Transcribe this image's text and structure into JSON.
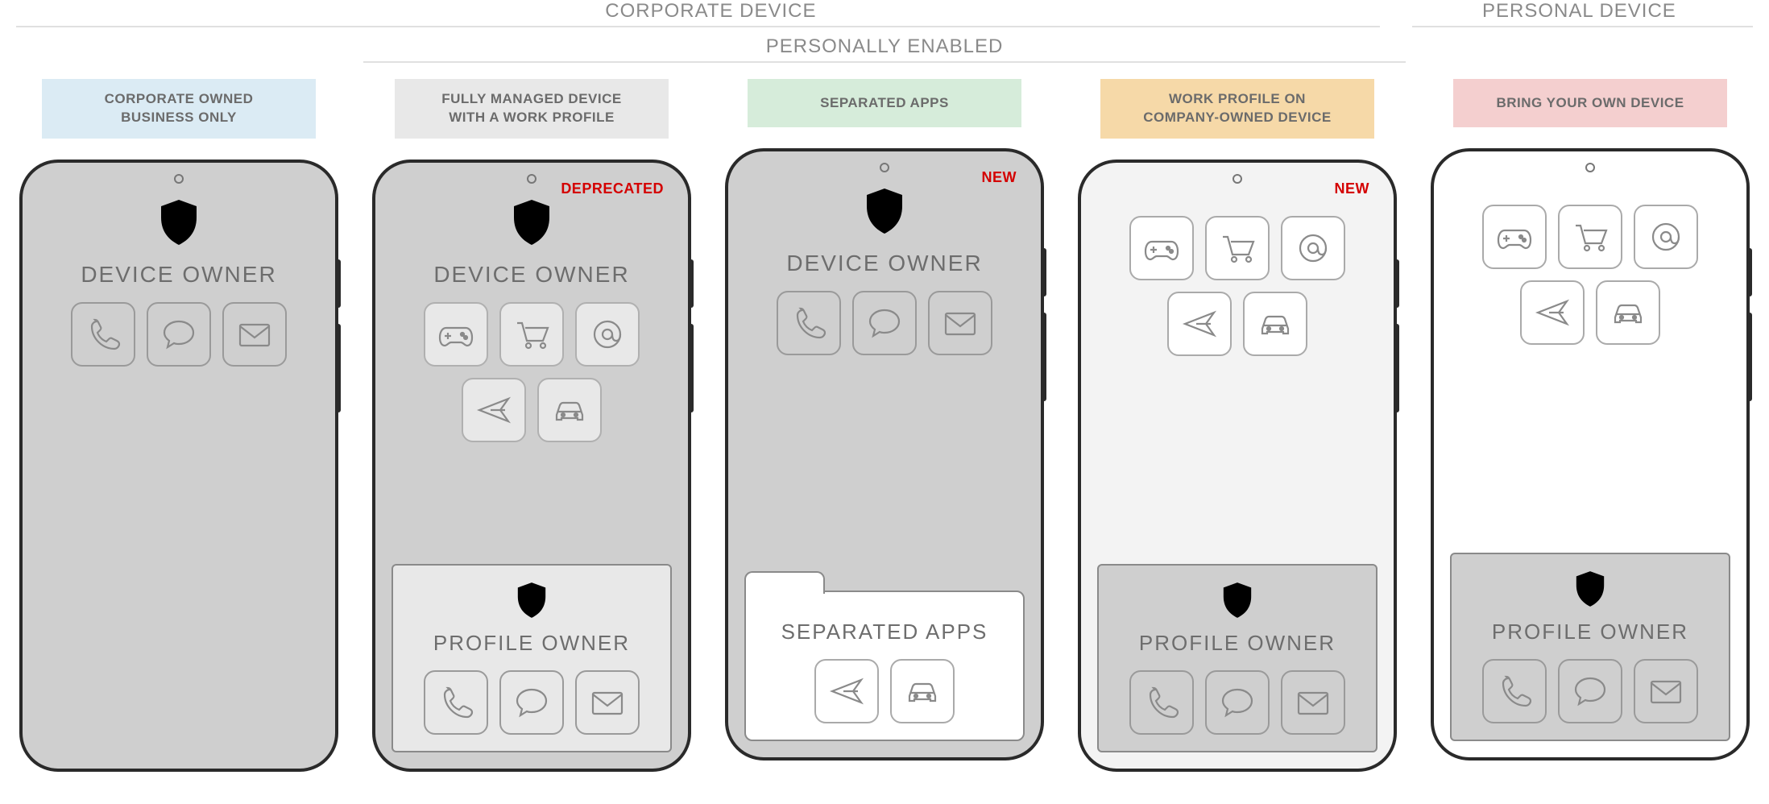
{
  "headers": {
    "corporate": "CORPORATE DEVICE",
    "personal": "PERSONAL DEVICE",
    "personally_enabled": "PERSONALLY ENABLED"
  },
  "badges": {
    "deprecated": "DEPRECATED",
    "new": "NEW"
  },
  "labels": {
    "device_owner": "DEVICE OWNER",
    "profile_owner": "PROFILE OWNER",
    "separated_apps": "SEPARATED APPS"
  },
  "columns": [
    {
      "pill": "CORPORATE OWNED\nBUSINESS ONLY",
      "pill_color": "#dbebf4"
    },
    {
      "pill": "FULLY MANAGED DEVICE\nWITH A WORK PROFILE",
      "pill_color": "#e8e8e8"
    },
    {
      "pill": "SEPARATED APPS",
      "pill_color": "#d6ecda"
    },
    {
      "pill": "WORK PROFILE ON\nCOMPANY-OWNED DEVICE",
      "pill_color": "#f6d9a8"
    },
    {
      "pill": "BRING YOUR OWN DEVICE",
      "pill_color": "#f4cfcf"
    }
  ],
  "icons": {
    "phone": "phone-icon",
    "chat": "chat-icon",
    "mail": "mail-icon",
    "game": "game-icon",
    "cart": "cart-icon",
    "at": "at-icon",
    "plane": "plane-icon",
    "car": "car-icon"
  }
}
